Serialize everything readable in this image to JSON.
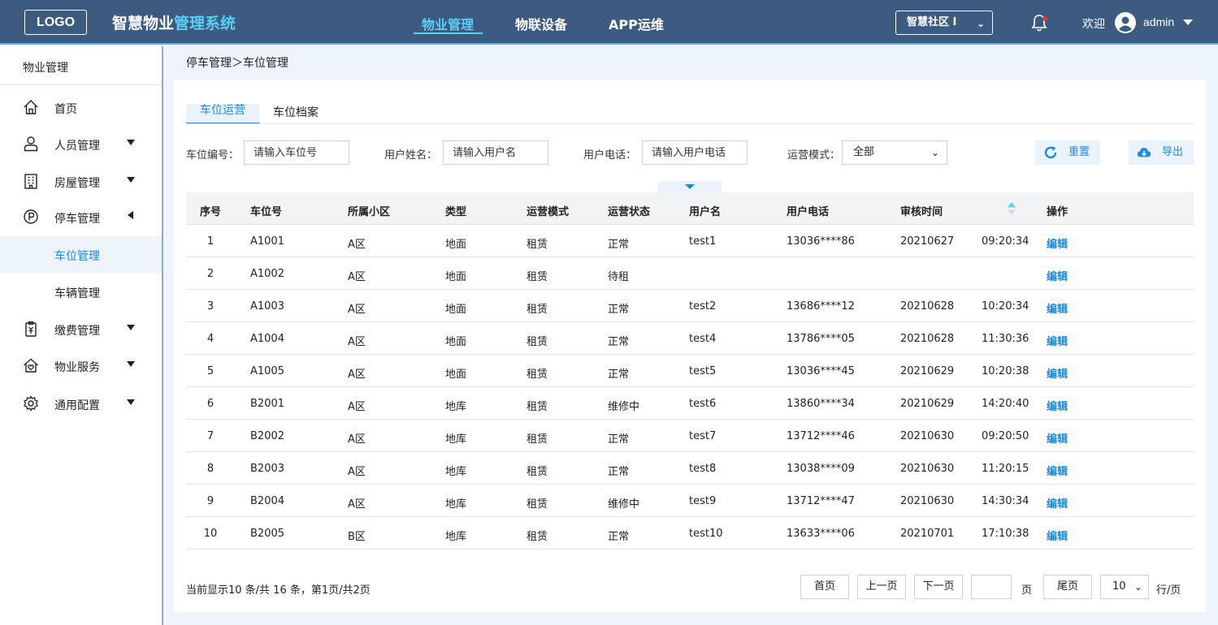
{
  "header": {
    "logo": "LOGO",
    "title_part1": "智慧物业",
    "title_part2": "管理系统",
    "nav": [
      "物业管理",
      "物联设备",
      "APP运维"
    ],
    "community": "智慧社区 I",
    "welcome": "欢迎",
    "username": "admin"
  },
  "sidebar": {
    "title": "物业管理",
    "items": [
      {
        "label": "首页",
        "icon": "home-icon"
      },
      {
        "label": "人员管理",
        "icon": "user-icon"
      },
      {
        "label": "房屋管理",
        "icon": "building-icon"
      },
      {
        "label": "停车管理",
        "icon": "parking-icon"
      },
      {
        "label": "缴费管理",
        "icon": "payment-icon"
      },
      {
        "label": "物业服务",
        "icon": "service-icon"
      },
      {
        "label": "通用配置",
        "icon": "gear-icon"
      }
    ],
    "sub_items": [
      "车位管理",
      "车辆管理"
    ]
  },
  "breadcrumb": "停车管理＞车位管理",
  "tabs": [
    "车位运营",
    "车位档案"
  ],
  "filters": {
    "space_no_label": "车位编号：",
    "space_no_placeholder": "请输入车位号",
    "user_name_label": "用户姓名：",
    "user_name_placeholder": "请输入用户名",
    "user_phone_label": "用户电话：",
    "user_phone_placeholder": "请输入用户电话",
    "mode_label": "运营模式：",
    "mode_value": "全部",
    "reset": "重置",
    "export": "导出"
  },
  "table": {
    "columns": [
      "序号",
      "车位号",
      "所属小区",
      "类型",
      "运营模式",
      "运营状态",
      "用户名",
      "用户电话",
      "审核时间",
      "操作"
    ],
    "rows": [
      [
        "1",
        "A1001",
        "A区",
        "地面",
        "租赁",
        "正常",
        "test1",
        "13036****86",
        "20210627",
        "09:20:34",
        "编辑"
      ],
      [
        "2",
        "A1002",
        "A区",
        "地面",
        "租赁",
        "待租",
        "",
        "",
        "",
        "",
        "编辑"
      ],
      [
        "3",
        "A1003",
        "A区",
        "地面",
        "租赁",
        "正常",
        "test2",
        "13686****12",
        "20210628",
        "10:20:34",
        "编辑"
      ],
      [
        "4",
        "A1004",
        "A区",
        "地面",
        "租赁",
        "正常",
        "test4",
        "13786****05",
        "20210628",
        "11:30:36",
        "编辑"
      ],
      [
        "5",
        "A1005",
        "A区",
        "地面",
        "租赁",
        "正常",
        "test5",
        "13036****45",
        "20210629",
        "10:20:38",
        "编辑"
      ],
      [
        "6",
        "B2001",
        "A区",
        "地库",
        "租赁",
        "维修中",
        "test6",
        "13860****34",
        "20210629",
        "14:20:40",
        "编辑"
      ],
      [
        "7",
        "B2002",
        "A区",
        "地库",
        "租赁",
        "正常",
        "test7",
        "13712****46",
        "20210630",
        "09:20:50",
        "编辑"
      ],
      [
        "8",
        "B2003",
        "A区",
        "地库",
        "租赁",
        "正常",
        "test8",
        "13038****09",
        "20210630",
        "11:20:15",
        "编辑"
      ],
      [
        "9",
        "B2004",
        "A区",
        "地库",
        "租赁",
        "维修中",
        "test9",
        "13712****47",
        "20210630",
        "14:30:34",
        "编辑"
      ],
      [
        "10",
        "B2005",
        "B区",
        "地库",
        "租赁",
        "正常",
        "test10",
        "13633****06",
        "20210701",
        "17:10:38",
        "编辑"
      ]
    ]
  },
  "pager": {
    "info": "当前显示10 条/共 16 条，第1页/共2页",
    "first": "首页",
    "prev": "上一页",
    "next": "下一页",
    "page_suffix": "页",
    "last": "尾页",
    "page_size": "10",
    "per_page_suffix": "行/页"
  },
  "colors": {
    "header_bg": "#3d5a80",
    "accent": "#1a8ad8",
    "highlight": "#5bd0f5"
  }
}
